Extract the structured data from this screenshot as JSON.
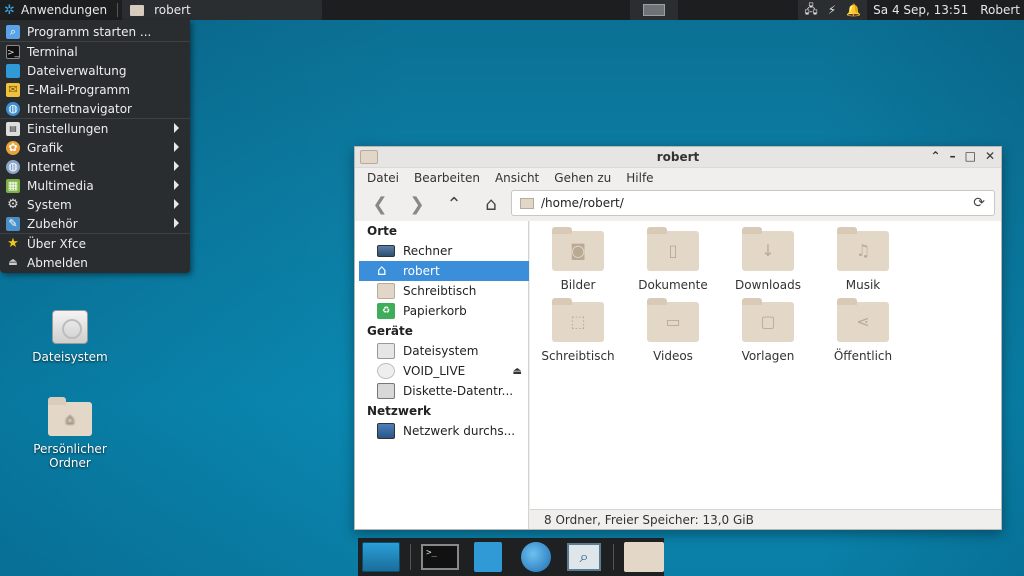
{
  "top_panel": {
    "apps_label": "Anwendungen",
    "task_title": "robert",
    "clock": "Sa  4 Sep, 13:51",
    "user": "Robert"
  },
  "app_menu": {
    "items": [
      {
        "label": "Programm starten ...",
        "icon": "run-icon",
        "submenu": false
      },
      {
        "label": "Terminal",
        "icon": "terminal-icon",
        "submenu": false
      },
      {
        "label": "Dateiverwaltung",
        "icon": "file-manager-icon",
        "submenu": false
      },
      {
        "label": "E-Mail-Programm",
        "icon": "mail-icon",
        "submenu": false
      },
      {
        "label": "Internetnavigator",
        "icon": "browser-icon",
        "submenu": false
      },
      {
        "label": "Einstellungen",
        "icon": "settings-icon",
        "submenu": true
      },
      {
        "label": "Grafik",
        "icon": "graphics-icon",
        "submenu": true
      },
      {
        "label": "Internet",
        "icon": "internet-icon",
        "submenu": true
      },
      {
        "label": "Multimedia",
        "icon": "multimedia-icon",
        "submenu": true
      },
      {
        "label": "System",
        "icon": "system-icon",
        "submenu": true
      },
      {
        "label": "Zubehör",
        "icon": "accessories-icon",
        "submenu": true
      },
      {
        "label": "Über Xfce",
        "icon": "star-icon",
        "submenu": false
      },
      {
        "label": "Abmelden",
        "icon": "logout-icon",
        "submenu": false
      }
    ]
  },
  "desktop_icons": [
    {
      "label": "Dateisystem"
    },
    {
      "label": "Persönlicher Ordner"
    }
  ],
  "file_manager": {
    "title": "robert",
    "menubar": [
      "Datei",
      "Bearbeiten",
      "Ansicht",
      "Gehen zu",
      "Hilfe"
    ],
    "path": "/home/robert/",
    "sidebar": {
      "places_header": "Orte",
      "places": [
        "Rechner",
        "robert",
        "Schreibtisch",
        "Papierkorb"
      ],
      "devices_header": "Geräte",
      "devices": [
        "Dateisystem",
        "VOID_LIVE",
        "Diskette-Datentr..."
      ],
      "network_header": "Netzwerk",
      "network": [
        "Netzwerk durchs..."
      ]
    },
    "folders": [
      {
        "label": "Bilder",
        "icon": "camera-icon"
      },
      {
        "label": "Dokumente",
        "icon": "document-icon"
      },
      {
        "label": "Downloads",
        "icon": "download-icon"
      },
      {
        "label": "Musik",
        "icon": "music-icon"
      },
      {
        "label": "Schreibtisch",
        "icon": "desktop-icon"
      },
      {
        "label": "Videos",
        "icon": "video-icon"
      },
      {
        "label": "Vorlagen",
        "icon": "template-icon"
      },
      {
        "label": "Öffentlich",
        "icon": "share-icon"
      }
    ],
    "status": "8 Ordner, Freier Speicher: 13,0 GiB"
  },
  "colors": {
    "selection": "#3b8eda",
    "panel": "#1c1e20",
    "folder": "#e3d7c7"
  }
}
